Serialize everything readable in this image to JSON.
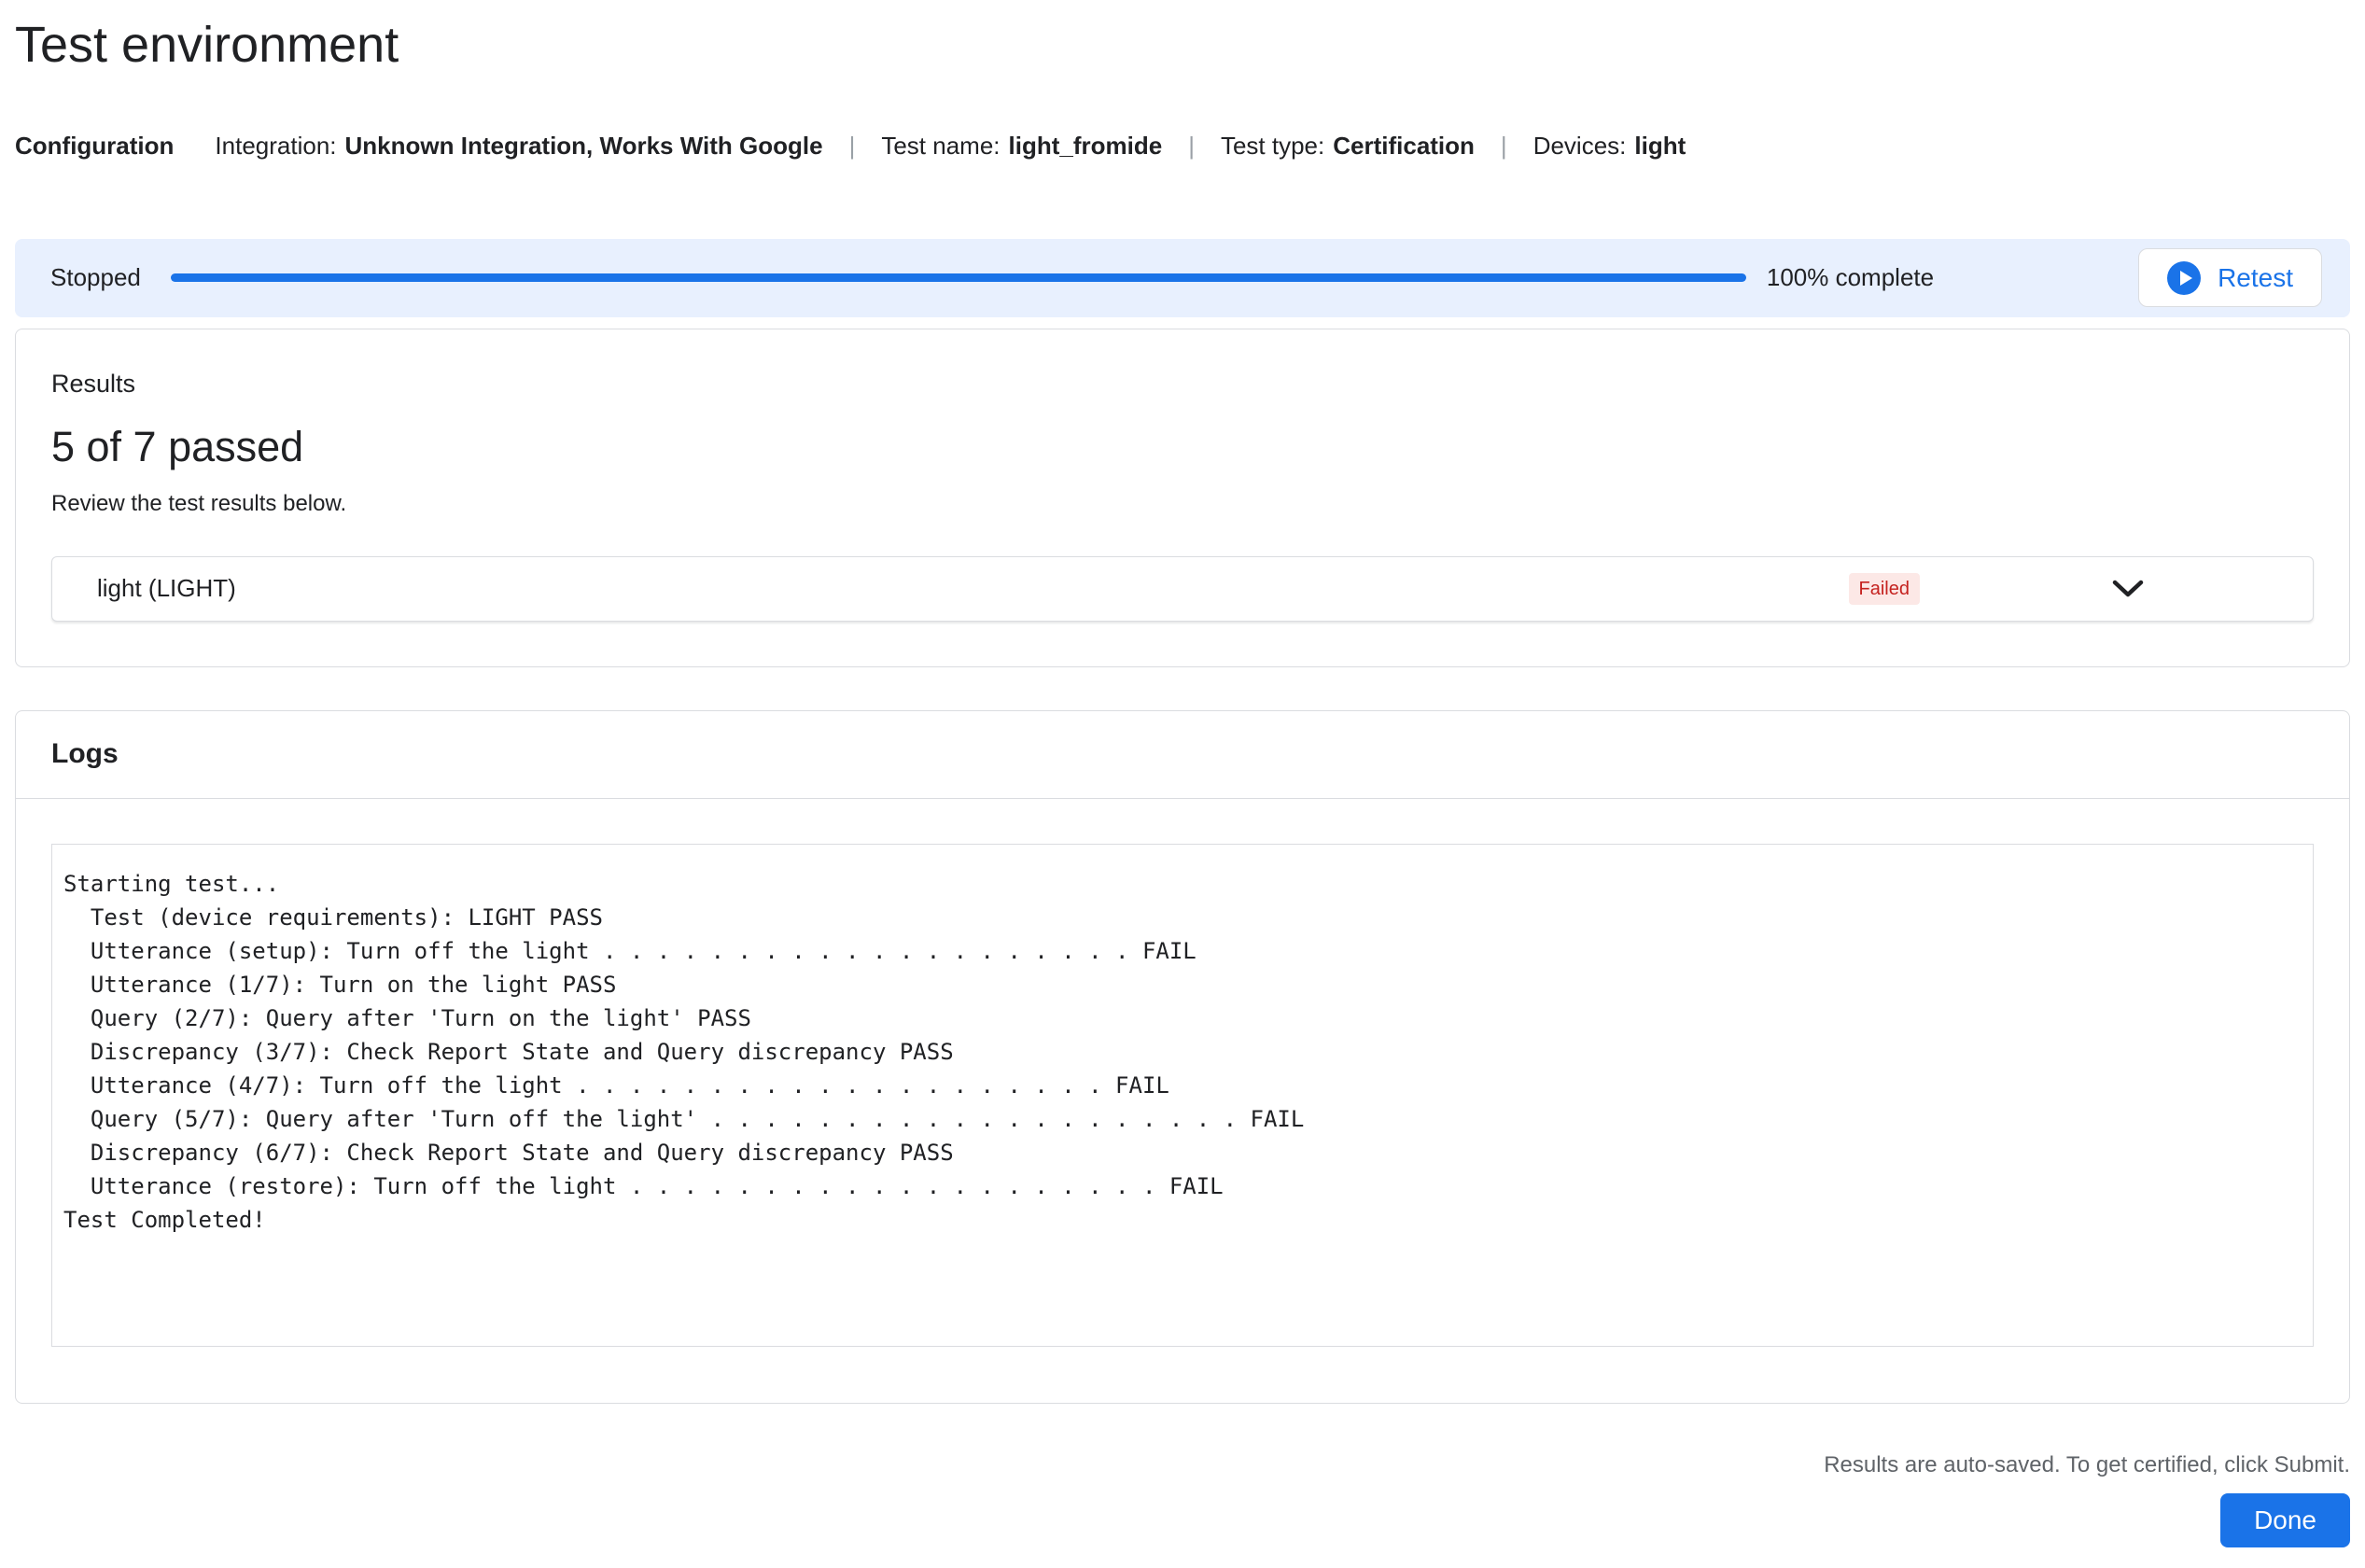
{
  "page": {
    "title": "Test environment"
  },
  "config": {
    "section_label": "Configuration",
    "separator": "|",
    "items": [
      {
        "label": "Integration:",
        "value": "Unknown Integration, Works With Google"
      },
      {
        "label": "Test name:",
        "value": "light_fromide"
      },
      {
        "label": "Test type:",
        "value": "Certification"
      },
      {
        "label": "Devices:",
        "value": "light"
      }
    ]
  },
  "progress": {
    "status": "Stopped",
    "percent": 100,
    "percent_label": "100% complete",
    "retest_label": "Retest"
  },
  "results": {
    "heading": "Results",
    "summary": "5 of 7 passed",
    "subtext": "Review the test results below.",
    "rows": [
      {
        "device": "light (LIGHT)",
        "status": "Failed"
      }
    ]
  },
  "logs": {
    "heading": "Logs",
    "lines": [
      "Starting test...",
      "  Test (device requirements): LIGHT PASS",
      "  Utterance (setup): Turn off the light . . . . . . . . . . . . . . . . . . . . FAIL",
      "  Utterance (1/7): Turn on the light PASS",
      "  Query (2/7): Query after 'Turn on the light' PASS",
      "  Discrepancy (3/7): Check Report State and Query discrepancy PASS",
      "  Utterance (4/7): Turn off the light . . . . . . . . . . . . . . . . . . . . FAIL",
      "  Query (5/7): Query after 'Turn off the light' . . . . . . . . . . . . . . . . . . . . FAIL",
      "  Discrepancy (6/7): Check Report State and Query discrepancy PASS",
      "  Utterance (restore): Turn off the light . . . . . . . . . . . . . . . . . . . . FAIL",
      "Test Completed!"
    ]
  },
  "footer": {
    "note": "Results are auto-saved. To get certified, click Submit.",
    "done_label": "Done"
  },
  "colors": {
    "accent": "#1a73e8",
    "banner_bg": "#e8f0fe",
    "border": "#dadce0",
    "text": "#202124",
    "secondary_text": "#5f6368",
    "failed_bg": "#fce8e6",
    "failed_text": "#c5221f"
  }
}
